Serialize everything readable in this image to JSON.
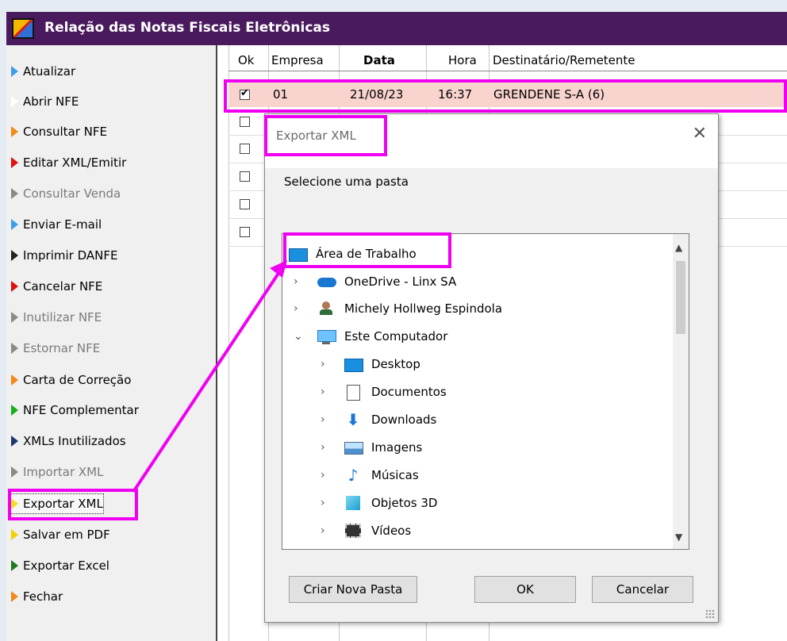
{
  "window": {
    "title": "Relação das Notas Fiscais Eletrônicas"
  },
  "sidebar": {
    "items": [
      {
        "label": "Atualizar",
        "color": "#3aa0e8",
        "disabled": false
      },
      {
        "label": "Abrir NFE",
        "color": "#ffffff",
        "disabled": false
      },
      {
        "label": "Consultar NFE",
        "color": "#f08a1a",
        "disabled": false
      },
      {
        "label": "Editar XML/Emitir",
        "color": "#e01010",
        "disabled": false
      },
      {
        "label": "Consultar Venda",
        "color": "#8a8a8a",
        "disabled": true
      },
      {
        "label": "Enviar E-mail",
        "color": "#3aa0e8",
        "disabled": false
      },
      {
        "label": "Imprimir DANFE",
        "color": "#222222",
        "disabled": false
      },
      {
        "label": "Cancelar NFE",
        "color": "#e01010",
        "disabled": false
      },
      {
        "label": "Inutilizar NFE",
        "color": "#8a8a8a",
        "disabled": true
      },
      {
        "label": "Estornar NFE",
        "color": "#8a8a8a",
        "disabled": true
      },
      {
        "label": "Carta de Correção",
        "color": "#f08a1a",
        "disabled": false
      },
      {
        "label": "NFE Complementar",
        "color": "#18b018",
        "disabled": false
      },
      {
        "label": "XMLs Inutilizados",
        "color": "#1a3a6a",
        "disabled": false
      },
      {
        "label": "Importar XML",
        "color": "#8a8a8a",
        "disabled": true
      },
      {
        "label": "Exportar XML",
        "color": "#f0e020",
        "disabled": false
      },
      {
        "label": "Salvar em PDF",
        "color": "#f0d000",
        "disabled": false
      },
      {
        "label": "Exportar Excel",
        "color": "#207a20",
        "disabled": false
      },
      {
        "label": "Fechar",
        "color": "#f08a1a",
        "disabled": false
      }
    ]
  },
  "grid": {
    "headers": {
      "ok": "Ok",
      "empresa": "Empresa",
      "data": "Data",
      "hora": "Hora",
      "dest": "Destinatário/Remetente"
    },
    "selected_row": {
      "checked": true,
      "empresa": "01",
      "data": "21/08/23",
      "hora": "16:37",
      "dest": "GRENDENE S-A (6)"
    }
  },
  "dialog": {
    "title": "Exportar XML",
    "prompt": "Selecione uma pasta",
    "tree": [
      {
        "label": "Área de Trabalho",
        "icon": "desktop-folder-icon",
        "level": 0,
        "chevron": ""
      },
      {
        "label": "OneDrive - Linx SA",
        "icon": "onedrive-cloud-icon",
        "level": 1,
        "chevron": "›"
      },
      {
        "label": "Michely Hollweg Espindola",
        "icon": "user-icon",
        "level": 1,
        "chevron": "›"
      },
      {
        "label": "Este Computador",
        "icon": "computer-icon",
        "level": 1,
        "chevron": "⌄"
      },
      {
        "label": "Desktop",
        "icon": "desktop-folder-icon",
        "level": 2,
        "chevron": "›"
      },
      {
        "label": "Documentos",
        "icon": "documents-icon",
        "level": 2,
        "chevron": "›"
      },
      {
        "label": "Downloads",
        "icon": "download-icon",
        "level": 2,
        "chevron": "›"
      },
      {
        "label": "Imagens",
        "icon": "pictures-icon",
        "level": 2,
        "chevron": "›"
      },
      {
        "label": "Músicas",
        "icon": "music-icon",
        "level": 2,
        "chevron": "›"
      },
      {
        "label": "Objetos 3D",
        "icon": "3d-objects-icon",
        "level": 2,
        "chevron": "›"
      },
      {
        "label": "Vídeos",
        "icon": "videos-icon",
        "level": 2,
        "chevron": "›"
      }
    ],
    "buttons": {
      "new_folder": "Criar Nova Pasta",
      "ok": "OK",
      "cancel": "Cancelar"
    }
  },
  "colors": {
    "accent": "#f000f0",
    "titlebar": "#4a1a5e",
    "row_highlight": "#f9d3cd"
  }
}
